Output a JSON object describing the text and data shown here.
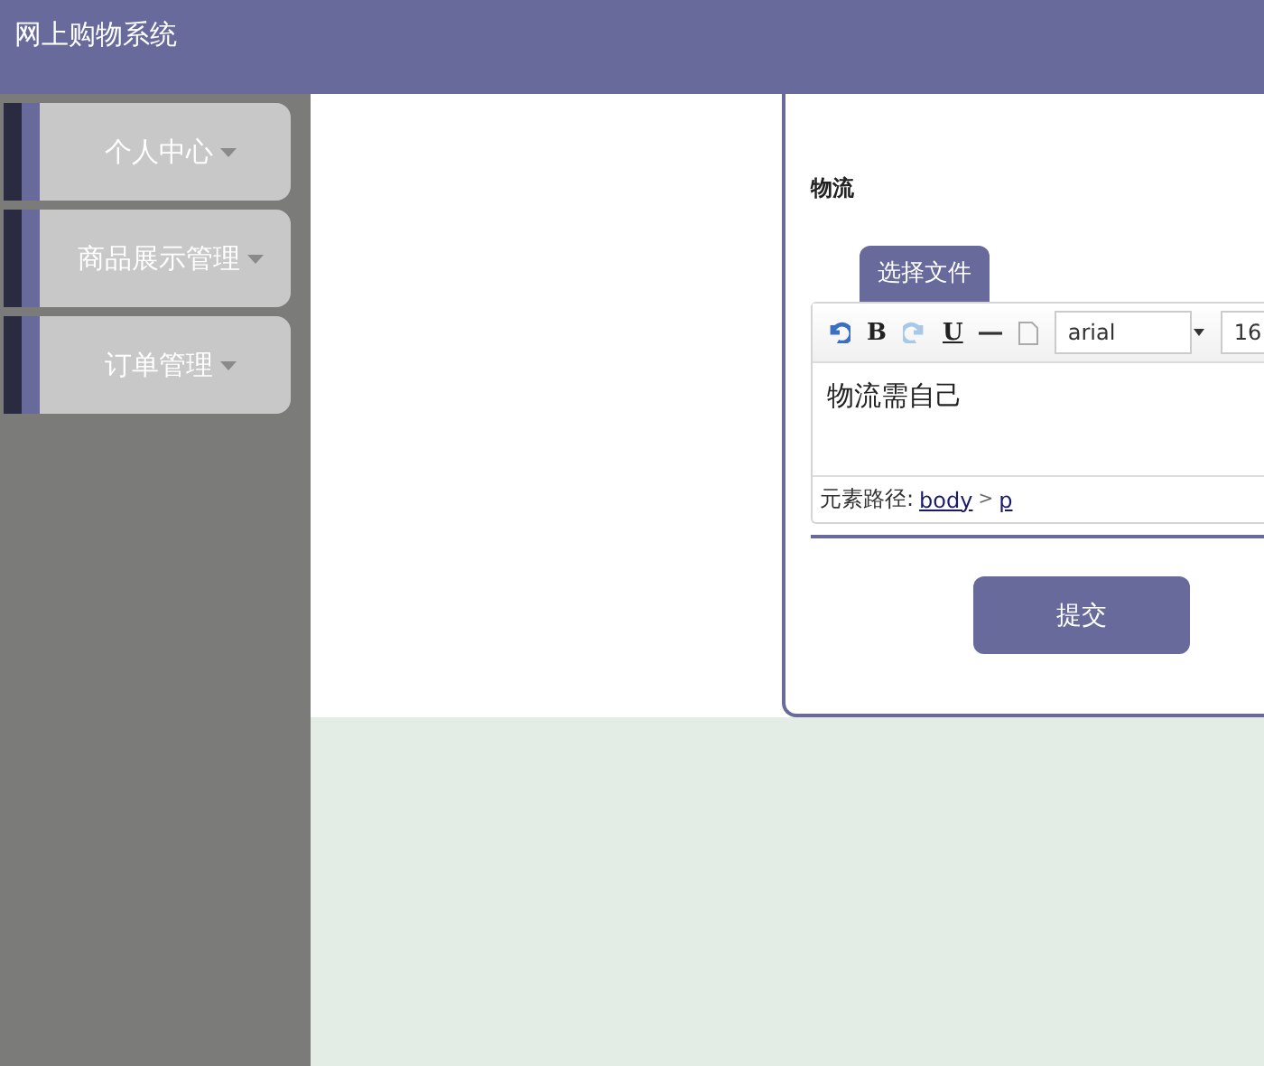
{
  "header": {
    "title": "网上购物系统"
  },
  "sidebar": {
    "items": [
      {
        "label": "个人中心"
      },
      {
        "label": "商品展示管理"
      },
      {
        "label": "订单管理"
      }
    ]
  },
  "form": {
    "field_label": "物流",
    "file_button": "选择文件",
    "editor": {
      "toolbar": {
        "bold": "B",
        "underline": "U",
        "font": "arial",
        "size": "16"
      },
      "content": "物流需自己",
      "path_label": "元素路径:",
      "path": [
        {
          "label": "body"
        },
        {
          "label": "p"
        }
      ],
      "path_separator": ">"
    },
    "submit": "提交"
  }
}
